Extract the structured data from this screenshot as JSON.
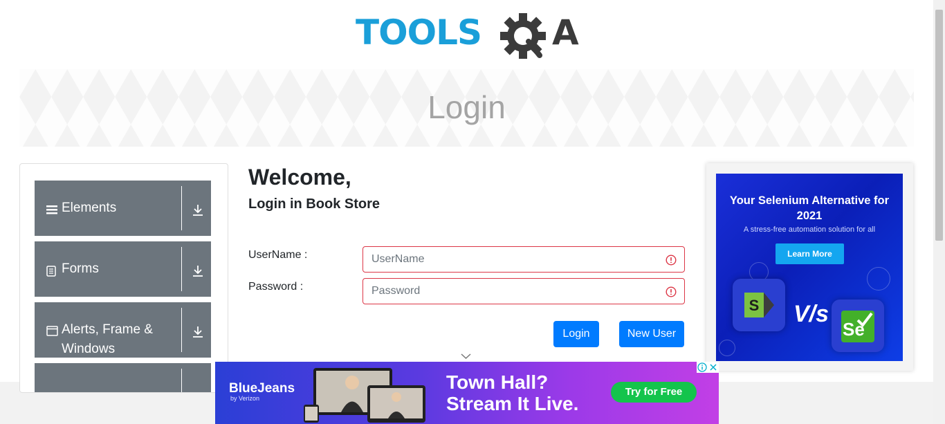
{
  "header": {
    "logo_text_left": "TOOLS",
    "logo_text_right": "A"
  },
  "banner": {
    "title": "Login"
  },
  "sidebar": {
    "groups": [
      {
        "label": "Elements",
        "icon": "hamburger-icon"
      },
      {
        "label": "Forms",
        "icon": "document-icon"
      },
      {
        "label": "Alerts, Frame & Windows",
        "icon": "window-icon"
      },
      {
        "label": "",
        "icon": "download-icon"
      }
    ]
  },
  "login": {
    "welcome": "Welcome,",
    "subtitle": "Login in Book Store",
    "username_label": "UserName :",
    "username_placeholder": "UserName",
    "password_label": "Password :",
    "password_placeholder": "Password",
    "login_button": "Login",
    "new_user_button": "New User"
  },
  "side_ad": {
    "headline": "Your Selenium Alternative for 2021",
    "tagline": "A stress-free automation solution for all",
    "cta": "Learn More",
    "vs_text": "V/s",
    "right_logo": "Se"
  },
  "bottom_ad": {
    "brand": "BlueJeans",
    "brand_sub": "by Verizon",
    "headline_line1": "Town Hall?",
    "headline_line2": "Stream It Live.",
    "cta": "Try for Free"
  },
  "colors": {
    "accent": "#007bff",
    "sidebar_bg": "#6c757d",
    "error": "#dc3545",
    "logo_blue": "#1a9fd9"
  }
}
